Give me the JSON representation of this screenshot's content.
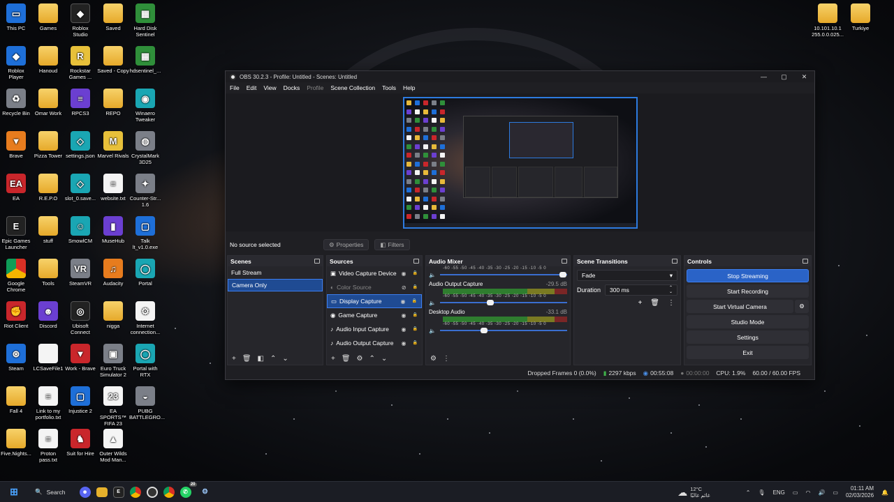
{
  "desktop": {
    "icons_left": [
      {
        "label": "This PC",
        "glyph": "▭",
        "style": "g-blue"
      },
      {
        "label": "Games",
        "glyph": "",
        "style": "g-folder"
      },
      {
        "label": "Roblox Studio",
        "glyph": "◆",
        "style": "g-dark"
      },
      {
        "label": "Saved",
        "glyph": "",
        "style": "g-folder"
      },
      {
        "label": "Hard Disk Sentinel",
        "glyph": "▦",
        "style": "g-green"
      },
      {
        "label": "Roblox Player",
        "glyph": "◆",
        "style": "g-blue"
      },
      {
        "label": "Hanoud",
        "glyph": "",
        "style": "g-folder"
      },
      {
        "label": "Rockstar Games ...",
        "glyph": "R",
        "style": "g-yellow"
      },
      {
        "label": "Saved - Copy",
        "glyph": "",
        "style": "g-folder"
      },
      {
        "label": "hdsentinel_...",
        "glyph": "▦",
        "style": "g-green"
      },
      {
        "label": "Recycle Bin",
        "glyph": "♻",
        "style": "g-gray"
      },
      {
        "label": "Omar Work",
        "glyph": "",
        "style": "g-folder"
      },
      {
        "label": "RPCS3",
        "glyph": "≡",
        "style": "g-purple"
      },
      {
        "label": "REPO",
        "glyph": "",
        "style": "g-folder"
      },
      {
        "label": "Winaero Tweaker",
        "glyph": "◉",
        "style": "g-teal"
      },
      {
        "label": "Brave",
        "glyph": "▼",
        "style": "g-orange"
      },
      {
        "label": "Pizza Tower",
        "glyph": "",
        "style": "g-folder"
      },
      {
        "label": "settings.json",
        "glyph": "◇",
        "style": "g-teal"
      },
      {
        "label": "Marvel Rivals",
        "glyph": "M",
        "style": "g-yellow"
      },
      {
        "label": "CrystalMark 3D25",
        "glyph": "◍",
        "style": "g-gray"
      },
      {
        "label": "EA",
        "glyph": "EA",
        "style": "g-red"
      },
      {
        "label": "R.E.P.O",
        "glyph": "",
        "style": "g-folder"
      },
      {
        "label": "slot_0.save...",
        "glyph": "◇",
        "style": "g-teal"
      },
      {
        "label": "website.txt",
        "glyph": "≡",
        "style": "g-file"
      },
      {
        "label": "Counter-Str... 1.6",
        "glyph": "✦",
        "style": "g-gray"
      },
      {
        "label": "Epic Games Launcher",
        "glyph": "E",
        "style": "g-dark"
      },
      {
        "label": "stuff",
        "glyph": "",
        "style": "g-folder"
      },
      {
        "label": "SmowlCM",
        "glyph": "☺",
        "style": "g-teal"
      },
      {
        "label": "MuseHub",
        "glyph": "▮",
        "style": "g-purple"
      },
      {
        "label": "Talk lt_v1.0.exe",
        "glyph": "▢",
        "style": "g-blue"
      },
      {
        "label": "Google Chrome",
        "glyph": "",
        "style": "g-chrome"
      },
      {
        "label": "Tools",
        "glyph": "",
        "style": "g-folder"
      },
      {
        "label": "SteamVR",
        "glyph": "VR",
        "style": "g-gray"
      },
      {
        "label": "Audacity",
        "glyph": "♫",
        "style": "g-orange"
      },
      {
        "label": "Portal",
        "glyph": "◯",
        "style": "g-teal"
      },
      {
        "label": "Riot Client",
        "glyph": "✊",
        "style": "g-red"
      },
      {
        "label": "Discord",
        "glyph": "☻",
        "style": "g-purple"
      },
      {
        "label": "Ubisoft Connect",
        "glyph": "◎",
        "style": "g-dark"
      },
      {
        "label": "nigga",
        "glyph": "",
        "style": "g-folder"
      },
      {
        "label": "Internet connection...",
        "glyph": "⚙",
        "style": "g-file"
      },
      {
        "label": "Steam",
        "glyph": "⊛",
        "style": "g-blue"
      },
      {
        "label": "LCSaveFile1",
        "glyph": "",
        "style": "g-file"
      },
      {
        "label": "Work - Brave",
        "glyph": "▼",
        "style": "g-red"
      },
      {
        "label": "Euro Truck Simulator 2",
        "glyph": "▣",
        "style": "g-gray"
      },
      {
        "label": "Portal with RTX",
        "glyph": "◯",
        "style": "g-teal"
      },
      {
        "label": "Fall 4",
        "glyph": "",
        "style": "g-folder"
      },
      {
        "label": "Link to my portfolio.txt",
        "glyph": "≡",
        "style": "g-file"
      },
      {
        "label": "Injustice 2",
        "glyph": "▢",
        "style": "g-blue"
      },
      {
        "label": "EA SPORTS™ FIFA 23",
        "glyph": "23",
        "style": "g-file"
      },
      {
        "label": "PUBG BATTLEGRO...",
        "glyph": "◒",
        "style": "g-gray"
      },
      {
        "label": "Five.Nights...",
        "glyph": "",
        "style": "g-folder"
      },
      {
        "label": "Proton pass.txt",
        "glyph": "≡",
        "style": "g-file"
      },
      {
        "label": "Suit for Hire",
        "glyph": "♞",
        "style": "g-red"
      },
      {
        "label": "Outer Wilds Mod Man...",
        "glyph": "▲",
        "style": "g-file"
      }
    ],
    "icons_right": [
      {
        "label": "10.101.10.1 255.0.0.025...",
        "glyph": "",
        "style": "g-folder"
      },
      {
        "label": "Turkiye",
        "glyph": "",
        "style": "g-folder"
      }
    ]
  },
  "obs": {
    "title": "OBS 30.2.3 - Profile: Untitled - Scenes: Untitled",
    "window_buttons": {
      "minimize": "—",
      "maximize": "▢",
      "close": "✕"
    },
    "menu": [
      "File",
      "Edit",
      "View",
      "Docks",
      "Profile",
      "Scene Collection",
      "Tools",
      "Help"
    ],
    "no_source": "No source selected",
    "properties_label": "Properties",
    "filters_label": "Filters",
    "scenes": {
      "title": "Scenes",
      "items": [
        "Full Stream",
        "Camera Only"
      ]
    },
    "sources": {
      "title": "Sources",
      "items": [
        {
          "label": "Video Capture Device",
          "icon": "▣"
        },
        {
          "label": "Color Source",
          "icon": "◐"
        },
        {
          "label": "Display Capture",
          "icon": "▭"
        },
        {
          "label": "Game Capture",
          "icon": "◉"
        },
        {
          "label": "Audio Input Capture",
          "icon": "♪"
        },
        {
          "label": "Audio Output Capture",
          "icon": "♪"
        }
      ]
    },
    "mixer": {
      "title": "Audio Mixer",
      "scale": "-60 -55 -50 -45 -40 -35 -30 -25 -20 -15 -10 -5 0",
      "channels": [
        {
          "name": "",
          "db": "",
          "volume": 0.97
        },
        {
          "name": "Audio Output Capture",
          "db": "-29.5 dB",
          "volume": 0.4
        },
        {
          "name": "Desktop Audio",
          "db": "-33.1 dB",
          "volume": 0.35
        }
      ]
    },
    "transitions": {
      "title": "Scene Transitions",
      "selected": "Fade",
      "duration_label": "Duration",
      "duration_value": "300 ms"
    },
    "controls": {
      "title": "Controls",
      "buttons": [
        "Stop Streaming",
        "Start Recording",
        "Start Virtual Camera",
        "Studio Mode",
        "Settings",
        "Exit"
      ]
    },
    "status": {
      "dropped": "Dropped Frames 0 (0.0%)",
      "kbps": "2297 kbps",
      "stream_time": "00:55:08",
      "rec_time": "00:00:00",
      "cpu": "CPU: 1.9%",
      "fps": "60.00 / 60.00 FPS"
    }
  },
  "taskbar": {
    "search": "Search",
    "weather_temp": "12°C",
    "weather_desc": "غائم غالبًا",
    "lang": "ENG",
    "time": "01:11 AM",
    "date": "02/03/2026",
    "badge": "20"
  }
}
